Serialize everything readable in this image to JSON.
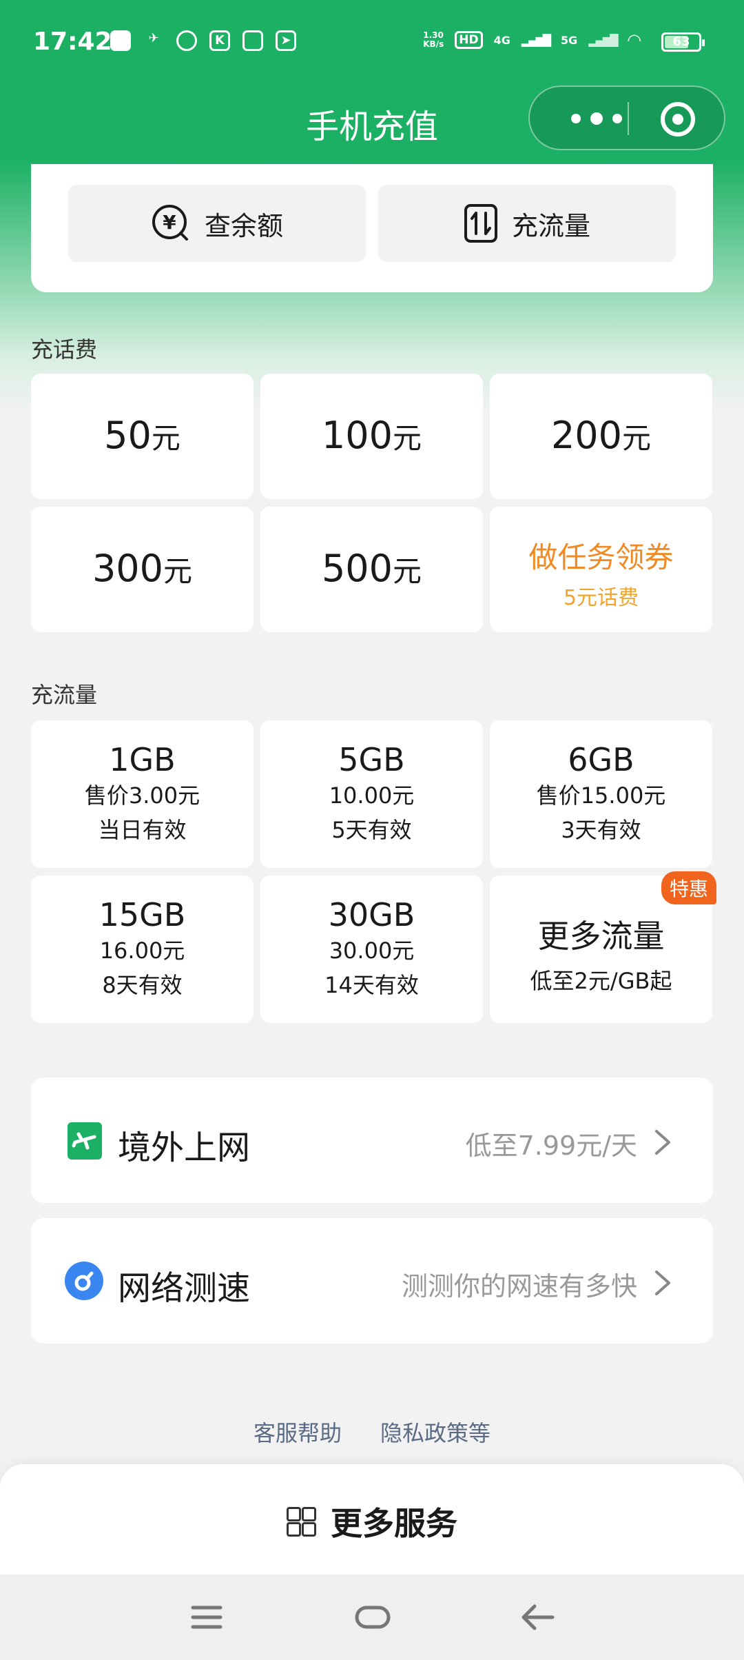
{
  "status_bar": {
    "time": "17:42",
    "net_speed": "1.30\nKB/s",
    "hd_label": "HD",
    "sig1": "4G",
    "sig2": "5G",
    "battery": "63"
  },
  "nav": {
    "title": "手机充值"
  },
  "quick_actions": [
    {
      "label": "查余额",
      "icon": "yuan-search-icon"
    },
    {
      "label": "充流量",
      "icon": "data-transfer-icon"
    }
  ],
  "fee_section": {
    "label": "充话费",
    "items": [
      {
        "amount": "50",
        "unit": "元"
      },
      {
        "amount": "100",
        "unit": "元"
      },
      {
        "amount": "200",
        "unit": "元"
      },
      {
        "amount": "300",
        "unit": "元"
      },
      {
        "amount": "500",
        "unit": "元"
      }
    ],
    "promo": {
      "title": "做任务领券",
      "subtitle": "5元话费"
    }
  },
  "data_section": {
    "label": "充流量",
    "items": [
      {
        "size": "1GB",
        "price": "售价3.00元",
        "validity": "当日有效"
      },
      {
        "size": "5GB",
        "price": "10.00元",
        "validity": "5天有效"
      },
      {
        "size": "6GB",
        "price": "售价15.00元",
        "validity": "3天有效"
      },
      {
        "size": "15GB",
        "price": "16.00元",
        "validity": "8天有效"
      },
      {
        "size": "30GB",
        "price": "30.00元",
        "validity": "14天有效"
      }
    ],
    "more": {
      "title": "更多流量",
      "subtitle": "低至2元/GB起",
      "badge": "特惠"
    }
  },
  "list_items": [
    {
      "title": "境外上网",
      "desc": "低至7.99元/天",
      "icon": "airplane-icon",
      "icon_color": "#1bb063"
    },
    {
      "title": "网络测速",
      "desc": "测测你的网速有多快",
      "icon": "speed-test-icon",
      "icon_color": "#3a86f0"
    }
  ],
  "footer_links": [
    "客服帮助",
    "隐私政策等"
  ],
  "bottom_sheet": {
    "label": "更多服务"
  },
  "colors": {
    "brand_green": "#1bb063",
    "promo_orange": "#f08a24",
    "badge_orange": "#f0641e"
  }
}
